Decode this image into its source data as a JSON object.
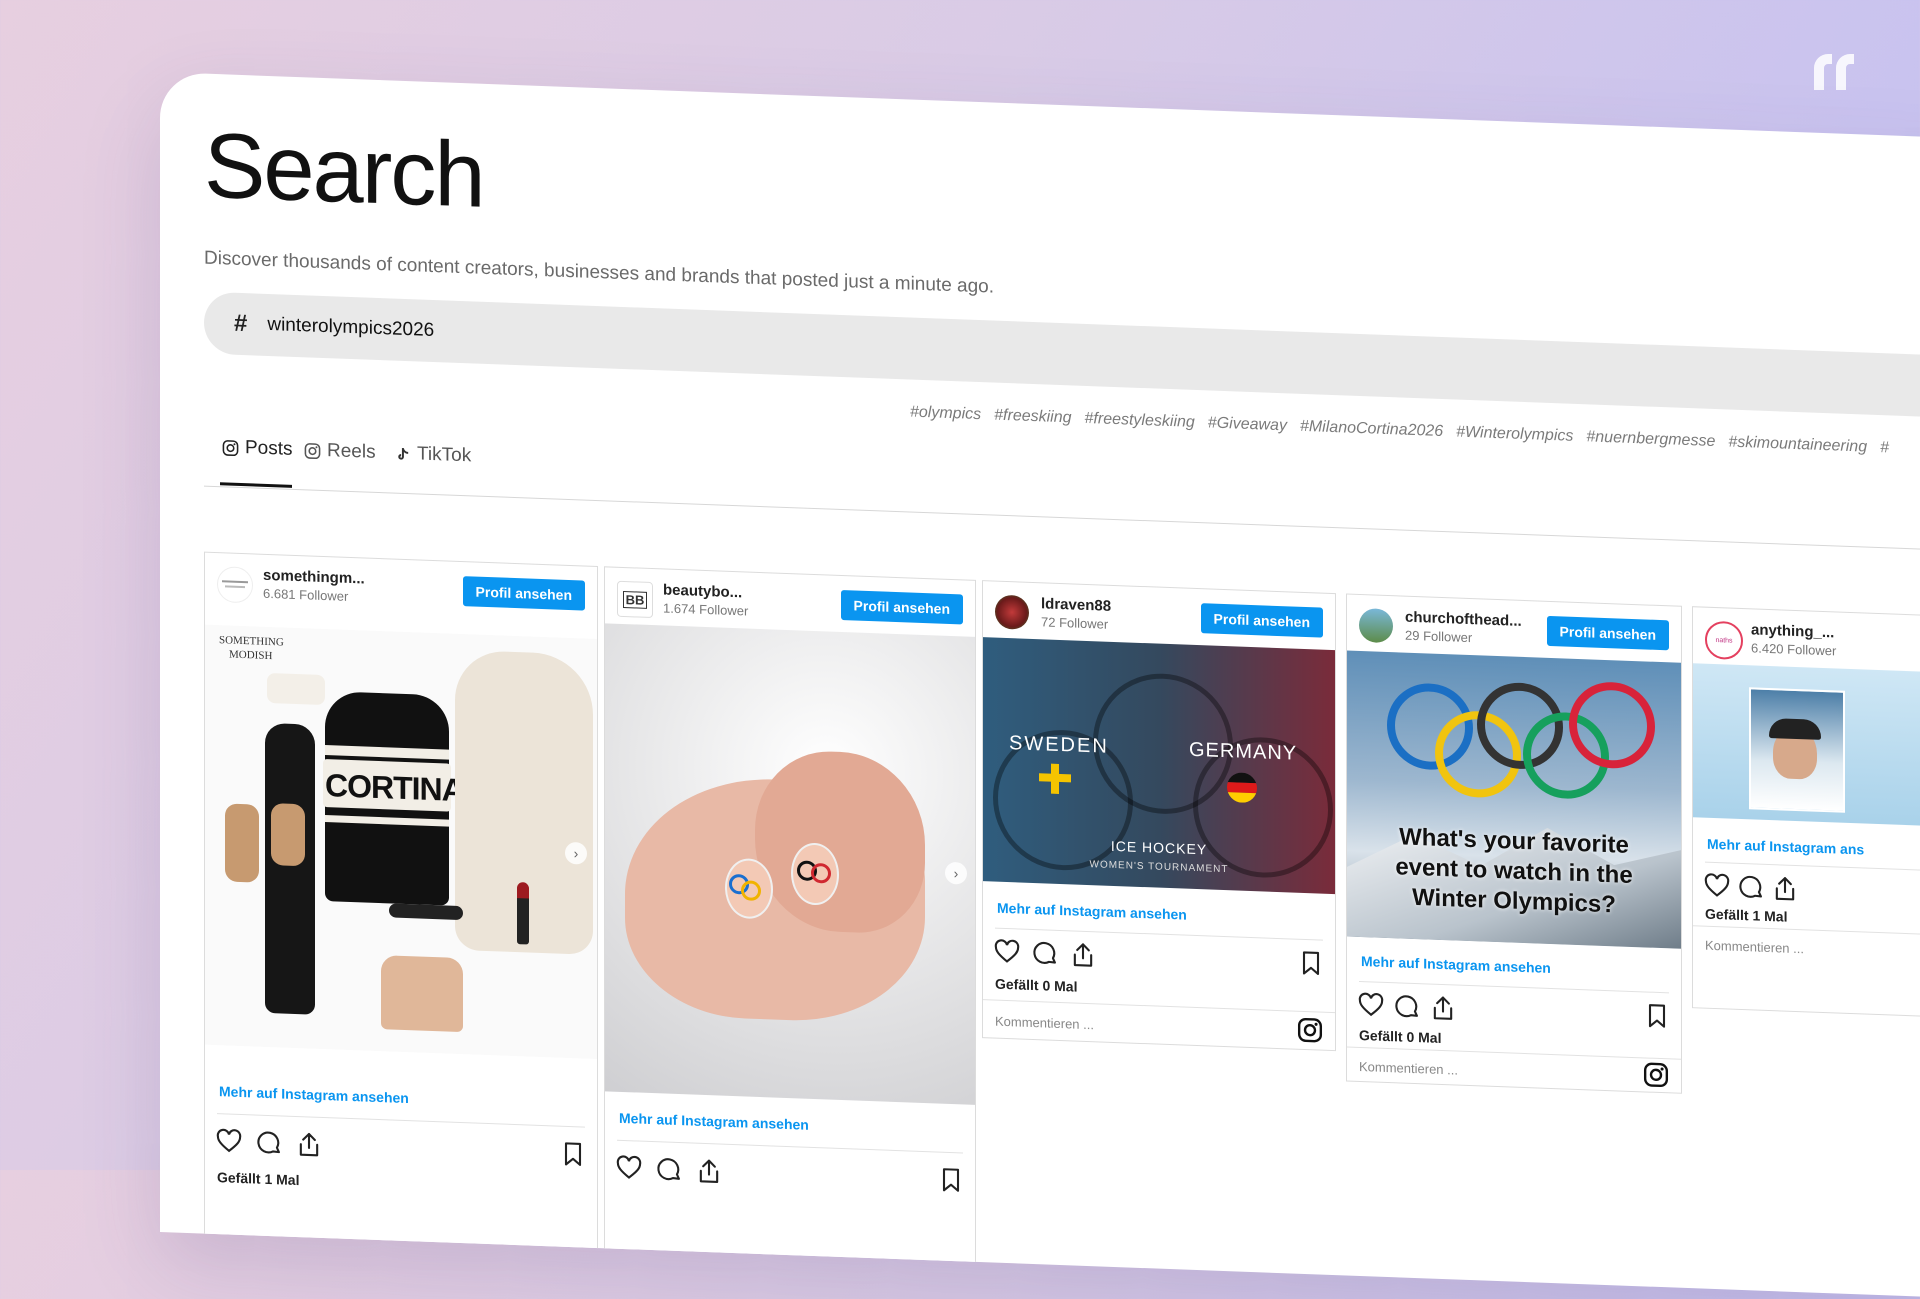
{
  "colors": {
    "accent": "#0a95f0",
    "search_bg": "#e9e9e9",
    "tag": "#7a7a7a"
  },
  "page": {
    "title": "Search",
    "subtitle": "Discover thousands of content creators, businesses and brands that posted just a minute ago."
  },
  "search": {
    "prefix": "#",
    "value": "winterolympics2026"
  },
  "hashtags": [
    "#olympics",
    "#freeskiing",
    "#freestyleskiing",
    "#Giveaway",
    "#MilanoCortina2026",
    "#Winterolympics",
    "#nuernbergmesse",
    "#skimountaineering",
    "#"
  ],
  "tabs": [
    {
      "label": "Posts",
      "icon": "instagram-icon",
      "active": true
    },
    {
      "label": "Reels",
      "icon": "instagram-icon",
      "active": false
    },
    {
      "label": "TikTok",
      "icon": "tiktok-icon",
      "active": false
    }
  ],
  "profile_button_label": "Profil ansehen",
  "more_link_label": "Mehr auf Instagram ansehen",
  "comment_placeholder": "Kommentieren ...",
  "posts": [
    {
      "username": "somethingm...",
      "followers": "6.681 Follower",
      "likes": "Gefällt 1 Mal",
      "image_text": [
        "SOMETHING",
        "MODISH",
        "CORTINA"
      ]
    },
    {
      "username": "beautybo...",
      "followers": "1.674 Follower",
      "likes": "",
      "avatar_text": "BB"
    },
    {
      "username": "ldraven88",
      "followers": "72 Follower",
      "likes": "Gefällt 0 Mal",
      "image_text": [
        "SWEDEN",
        "GERMANY",
        "ICE HOCKEY",
        "WOMEN'S TOURNAMENT"
      ]
    },
    {
      "username": "churchofthead...",
      "followers": "29 Follower",
      "likes": "Gefällt 0 Mal",
      "image_text": [
        "What's your favorite",
        "event to watch in the",
        "Winter Olympics?"
      ]
    },
    {
      "username": "anything_...",
      "followers": "6.420 Follower",
      "likes": "Gefällt 1 Mal",
      "more_link": "Mehr auf Instagram ans",
      "avatar_text": "naths"
    }
  ]
}
